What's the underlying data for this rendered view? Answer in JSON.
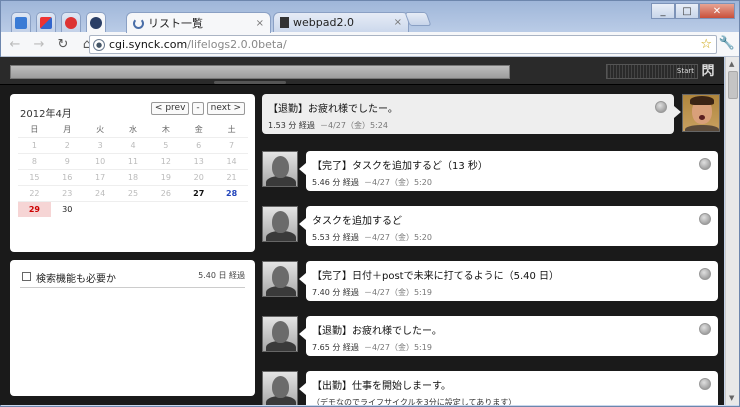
{
  "browser": {
    "tabs": [
      {
        "label": "リスト一覧",
        "active": true
      },
      {
        "label": "webpad2.0",
        "active": false
      }
    ],
    "close_glyph": "×",
    "url": {
      "domain": "cgi.synck.com",
      "path": "/lifelogs2.0.0beta/"
    }
  },
  "header": {
    "start_label": "Start",
    "logo_glyph": "閃"
  },
  "calendar": {
    "title": "2012年4月",
    "nav": {
      "prev": "< prev",
      "mid": "-",
      "next": "next >"
    },
    "weekdays": [
      "日",
      "月",
      "火",
      "水",
      "木",
      "金",
      "土"
    ],
    "rows": [
      [
        "1",
        "2",
        "3",
        "4",
        "5",
        "6",
        "7"
      ],
      [
        "8",
        "9",
        "10",
        "11",
        "12",
        "13",
        "14"
      ],
      [
        "15",
        "16",
        "17",
        "18",
        "19",
        "20",
        "21"
      ],
      [
        "22",
        "23",
        "24",
        "25",
        "26",
        "27",
        "28"
      ],
      [
        "29",
        "30",
        "",
        "",
        "",
        "",
        ""
      ]
    ]
  },
  "task": {
    "label": "検索機能も必要か",
    "time": "5.40 日 経過"
  },
  "posts": [
    {
      "msg": "【退勤】お疲れ様でしたー。",
      "elapsed": "1.53 分 経過",
      "date": "－4/27（金）5:24"
    },
    {
      "msg": "【完了】タスクを追加するど（13 秒）",
      "elapsed": "5.46 分 経過",
      "date": "－4/27（金）5:20"
    },
    {
      "msg": "タスクを追加するど",
      "elapsed": "5.53 分 経過",
      "date": "－4/27（金）5:20"
    },
    {
      "msg": "【完了】日付＋postで未来に打てるように（5.40 日）",
      "elapsed": "7.40 分 経過",
      "date": "－4/27（金）5:19"
    },
    {
      "msg": "【退勤】お疲れ様でしたー。",
      "elapsed": "7.65 分 経過",
      "date": "－4/27（金）5:19"
    },
    {
      "msg": "【出勤】仕事を開始しまーす。",
      "elapsed": "（デモなのでライフサイクルを3分に設定してあります）",
      "date": ""
    }
  ]
}
